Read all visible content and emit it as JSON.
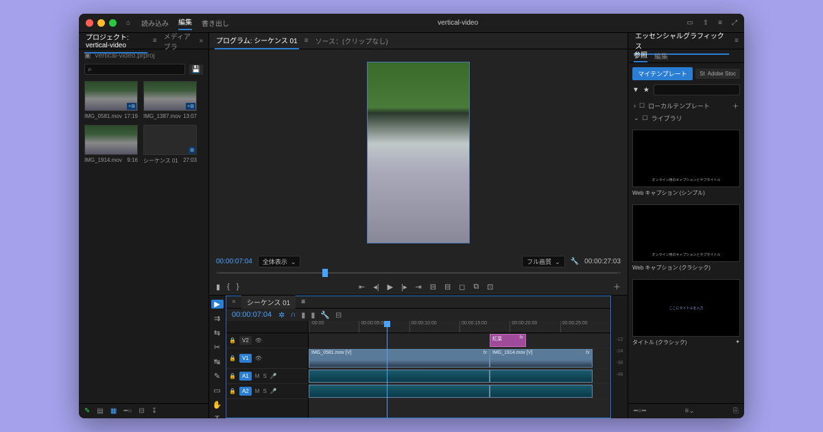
{
  "window": {
    "title": "vertical-video"
  },
  "topnav": {
    "import": "読み込み",
    "edit": "編集",
    "export": "書き出し"
  },
  "panels": {
    "project": {
      "title": "プロジェクト: vertical-video",
      "media": "メディアブラ"
    },
    "program": {
      "title": "プログラム: シーケンス 01",
      "source": "ソース：(クリップなし)"
    }
  },
  "project": {
    "filename": "vertical-video.prproj",
    "search_placeholder": "",
    "bins": [
      {
        "name": "IMG_0581.mov",
        "dur": "17:19"
      },
      {
        "name": "IMG_1387.mov",
        "dur": "13:07"
      },
      {
        "name": "IMG_1914.mov",
        "dur": "9:16"
      },
      {
        "name": "シーケンス 01",
        "dur": "27:03",
        "seq": true
      }
    ]
  },
  "monitor": {
    "tc_in": "00:00:07:04",
    "fit": "全体表示",
    "quality": "フル画質",
    "tc_out": "00:00:27:03"
  },
  "timeline": {
    "seq_name": "シーケンス 01",
    "tc": "00:00:07:04",
    "ruler": [
      ":00:00",
      "00:00:05:00",
      "00:00:10:00",
      "00:00:15:00",
      "00:00:20:00",
      "00:00:25:00"
    ],
    "tracks": {
      "v2": "V2",
      "v1": "V1",
      "a1": "A1",
      "a2": "A2"
    },
    "clips": {
      "v2_gfx": "紅葉",
      "v1_a": "IMG_0581.mov [V]",
      "v1_b": "IMG_1914.mov [V]",
      "fx": "fx"
    },
    "meters": [
      "-12",
      "-24",
      "-36",
      "-48"
    ]
  },
  "egp": {
    "title": "エッセンシャルグラフィックス",
    "browse": "参照",
    "edit": "編集",
    "mytemplates": "マイテンプレート",
    "adobestock": "Adobe Stoc",
    "local": "ローカルテンプレート",
    "library": "ライブラリ",
    "templates": [
      {
        "caption": "オンライン用のキャプションとサブタイトル",
        "label": "Web キャプション (シンプル)"
      },
      {
        "caption": "オンライン用のキャプションとサブタイトル",
        "label": "Web キャプション (クラシック)"
      },
      {
        "caption": "ここにタイトルを入力",
        "label": "タイトル (クラシック)"
      }
    ]
  }
}
